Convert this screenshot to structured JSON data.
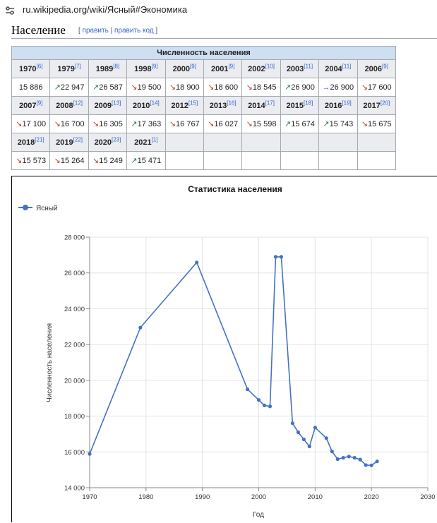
{
  "browser": {
    "url": "ru.wikipedia.org/wiki/Ясный#Экономика",
    "site_icon": "tune-icon"
  },
  "section": {
    "title": "Население",
    "open_bracket": "[",
    "edit": "править",
    "separator": "|",
    "edit_code": "править код",
    "close_bracket": "]"
  },
  "table": {
    "caption": "Численность населения",
    "rows": [
      {
        "cells": [
          {
            "year": "1970",
            "ref": "[6]",
            "arrow": "",
            "value": "15 886"
          },
          {
            "year": "1979",
            "ref": "[7]",
            "arrow": "up",
            "value": "22 947"
          },
          {
            "year": "1989",
            "ref": "[8]",
            "arrow": "up",
            "value": "26 587"
          },
          {
            "year": "1998",
            "ref": "[9]",
            "arrow": "down",
            "value": "19 500"
          },
          {
            "year": "2000",
            "ref": "[9]",
            "arrow": "down",
            "value": "18 900"
          },
          {
            "year": "2001",
            "ref": "[9]",
            "arrow": "down",
            "value": "18 600"
          },
          {
            "year": "2002",
            "ref": "[10]",
            "arrow": "down",
            "value": "18 545"
          },
          {
            "year": "2003",
            "ref": "[11]",
            "arrow": "up",
            "value": "26 900"
          },
          {
            "year": "2004",
            "ref": "[11]",
            "arrow": "flat",
            "value": "26 900"
          },
          {
            "year": "2006",
            "ref": "[9]",
            "arrow": "down",
            "value": "17 600"
          }
        ]
      },
      {
        "cells": [
          {
            "year": "2007",
            "ref": "[9]",
            "arrow": "down",
            "value": "17 100"
          },
          {
            "year": "2008",
            "ref": "[12]",
            "arrow": "down",
            "value": "16 700"
          },
          {
            "year": "2009",
            "ref": "[13]",
            "arrow": "down",
            "value": "16 305"
          },
          {
            "year": "2010",
            "ref": "[14]",
            "arrow": "up",
            "value": "17 363"
          },
          {
            "year": "2012",
            "ref": "[15]",
            "arrow": "down",
            "value": "16 767"
          },
          {
            "year": "2013",
            "ref": "[16]",
            "arrow": "down",
            "value": "16 027"
          },
          {
            "year": "2014",
            "ref": "[17]",
            "arrow": "down",
            "value": "15 598"
          },
          {
            "year": "2015",
            "ref": "[18]",
            "arrow": "up",
            "value": "15 674"
          },
          {
            "year": "2016",
            "ref": "[19]",
            "arrow": "up",
            "value": "15 743"
          },
          {
            "year": "2017",
            "ref": "[20]",
            "arrow": "down",
            "value": "15 675"
          }
        ]
      },
      {
        "cells": [
          {
            "year": "2018",
            "ref": "[21]",
            "arrow": "down",
            "value": "15 573"
          },
          {
            "year": "2019",
            "ref": "[22]",
            "arrow": "down",
            "value": "15 264"
          },
          {
            "year": "2020",
            "ref": "[23]",
            "arrow": "down",
            "value": "15 249"
          },
          {
            "year": "2021",
            "ref": "[1]",
            "arrow": "up",
            "value": "15 471"
          },
          {
            "year": "",
            "ref": "",
            "arrow": "",
            "value": ""
          },
          {
            "year": "",
            "ref": "",
            "arrow": "",
            "value": ""
          },
          {
            "year": "",
            "ref": "",
            "arrow": "",
            "value": ""
          },
          {
            "year": "",
            "ref": "",
            "arrow": "",
            "value": ""
          },
          {
            "year": "",
            "ref": "",
            "arrow": "",
            "value": ""
          },
          {
            "year": "",
            "ref": "",
            "arrow": "",
            "value": ""
          }
        ]
      }
    ],
    "arrows": {
      "up": "↗",
      "down": "↘",
      "flat": "→"
    }
  },
  "chart_data": {
    "type": "line",
    "title": "Статистика населения",
    "xlabel": "Год",
    "ylabel": "Численность населения",
    "xlim": [
      1970,
      2030
    ],
    "ylim": [
      14000,
      28000
    ],
    "xticks": [
      "1970",
      "1980",
      "1990",
      "2000",
      "2010",
      "2020",
      "2030"
    ],
    "yticks": [
      "14 000",
      "16 000",
      "18 000",
      "20 000",
      "22 000",
      "24 000",
      "26 000",
      "28 000"
    ],
    "grid": true,
    "legend": "top-left",
    "color": "#4472c4",
    "series": [
      {
        "name": "Ясный",
        "x": [
          1970,
          1979,
          1989,
          1998,
          2000,
          2001,
          2002,
          2003,
          2004,
          2006,
          2007,
          2008,
          2009,
          2010,
          2012,
          2013,
          2014,
          2015,
          2016,
          2017,
          2018,
          2019,
          2020,
          2021
        ],
        "y": [
          15886,
          22947,
          26587,
          19500,
          18900,
          18600,
          18545,
          26900,
          26900,
          17600,
          17100,
          16700,
          16305,
          17363,
          16767,
          16027,
          15598,
          15674,
          15743,
          15675,
          15573,
          15264,
          15249,
          15471
        ]
      }
    ]
  }
}
